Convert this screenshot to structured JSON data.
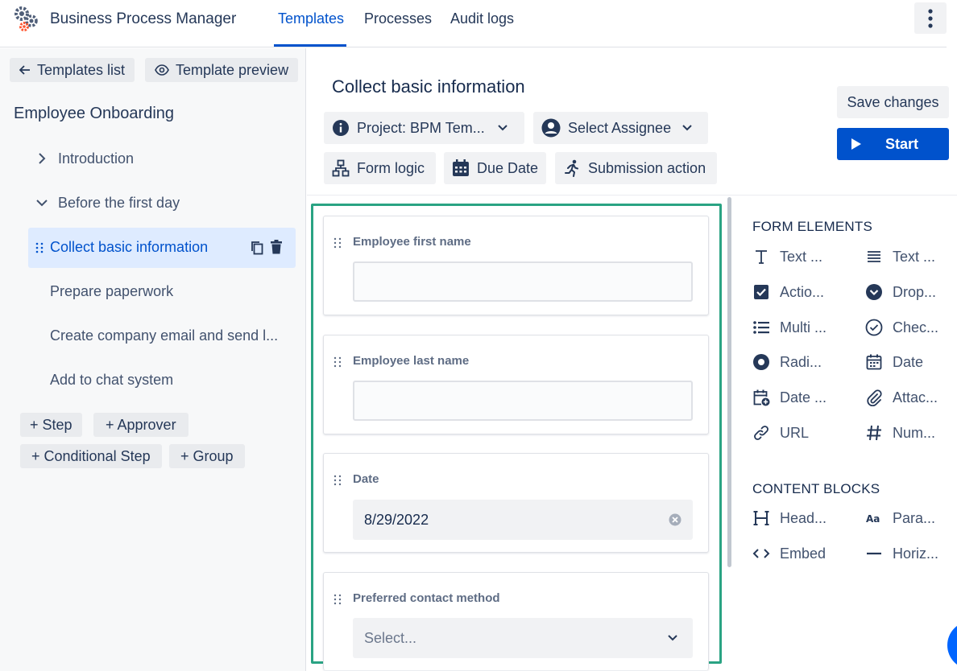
{
  "app": {
    "title": "Business Process Manager",
    "accent": "#0052cc"
  },
  "nav": {
    "tabs": [
      {
        "label": "Templates",
        "active": true
      },
      {
        "label": "Processes",
        "active": false
      },
      {
        "label": "Audit logs",
        "active": false
      }
    ]
  },
  "left": {
    "back_label": "Templates list",
    "preview_label": "Template preview",
    "template_name": "Employee Onboarding",
    "tree": [
      {
        "label": "Introduction",
        "type": "section-collapsed"
      },
      {
        "label": "Before the first day",
        "type": "section-expanded"
      },
      {
        "label": "Collect basic information",
        "type": "step",
        "selected": true
      },
      {
        "label": "Prepare paperwork",
        "type": "step"
      },
      {
        "label": "Create company email and send l...",
        "type": "step"
      },
      {
        "label": "Add to chat system",
        "type": "step"
      }
    ],
    "add_buttons": [
      "+ Step",
      "+ Approver",
      "+ Conditional Step",
      "+ Group"
    ]
  },
  "header": {
    "step_title": "Collect basic information",
    "project_label": "Project: BPM Tem...",
    "assignee_label": "Select Assignee",
    "form_logic_label": "Form logic",
    "due_date_label": "Due Date",
    "submission_label": "Submission action",
    "save_label": "Save changes",
    "start_label": "Start"
  },
  "form": {
    "fields": [
      {
        "label": "Employee first name",
        "value": ""
      },
      {
        "label": "Employee last name",
        "value": ""
      },
      {
        "label": "Date",
        "value": "8/29/2022"
      },
      {
        "label": "Preferred contact method",
        "placeholder": "Select..."
      }
    ]
  },
  "palette": {
    "form_elements_title": "FORM ELEMENTS",
    "form_elements": [
      {
        "label": "Text ...",
        "icon": "text-t-icon"
      },
      {
        "label": "Text ...",
        "icon": "text-lines-icon"
      },
      {
        "label": "Actio...",
        "icon": "checkbox-icon"
      },
      {
        "label": "Drop...",
        "icon": "dropdown-icon"
      },
      {
        "label": "Multi ...",
        "icon": "multi-list-icon"
      },
      {
        "label": "Chec...",
        "icon": "check-circle-icon"
      },
      {
        "label": "Radi...",
        "icon": "radio-icon"
      },
      {
        "label": "Date",
        "icon": "calendar-icon"
      },
      {
        "label": "Date ...",
        "icon": "calendar-plus-icon"
      },
      {
        "label": "Attac...",
        "icon": "paperclip-icon"
      },
      {
        "label": "URL",
        "icon": "link-icon"
      },
      {
        "label": "Num...",
        "icon": "hash-icon"
      }
    ],
    "content_blocks_title": "CONTENT BLOCKS",
    "content_blocks": [
      {
        "label": "Head...",
        "icon": "heading-icon"
      },
      {
        "label": "Para...",
        "icon": "paragraph-icon"
      },
      {
        "label": "Embed",
        "icon": "code-icon"
      },
      {
        "label": "Horiz...",
        "icon": "horizontal-rule-icon"
      }
    ]
  }
}
